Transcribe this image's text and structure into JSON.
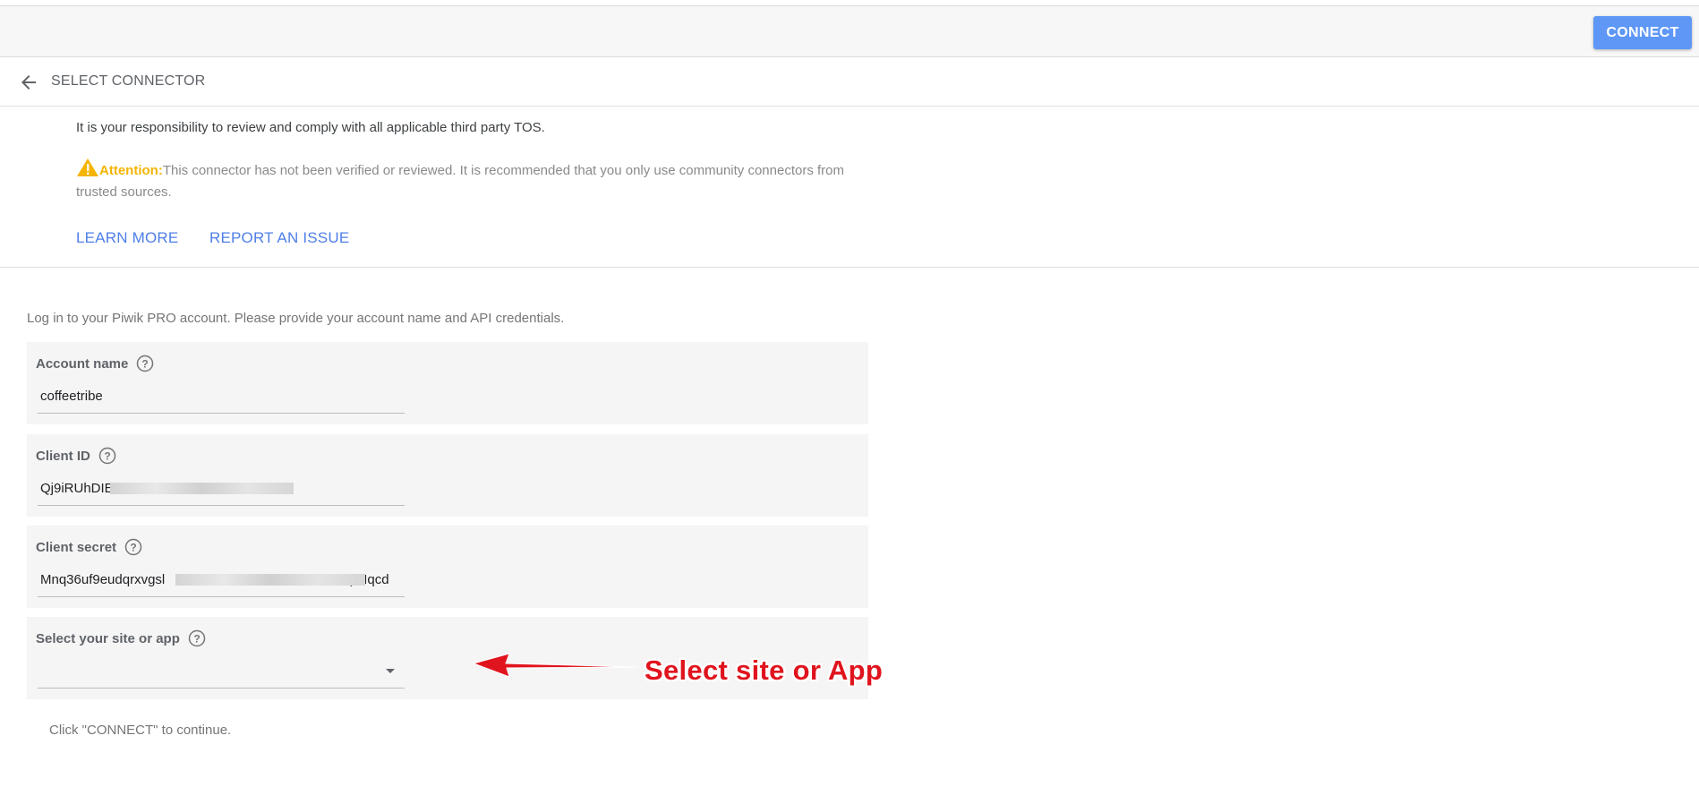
{
  "toolbar": {
    "connect_label": "CONNECT"
  },
  "header": {
    "title": "SELECT CONNECTOR",
    "back_icon": "arrow-back-icon"
  },
  "notice": {
    "tos": "It is your responsibility to review and comply with all applicable third party TOS.",
    "attention_label": "Attention:",
    "attention_text": "This connector has not been verified or reviewed. It is recommended that you only use community connectors from trusted sources.",
    "warning_icon": "warning-icon",
    "warning_color": "#f4b400"
  },
  "links": {
    "learn_more": "LEARN MORE",
    "report_issue": "REPORT AN ISSUE",
    "color": "#4f7fe8"
  },
  "form": {
    "intro": "Log in to your Piwik PRO account. Please provide your account name and API credentials.",
    "account_name": {
      "label": "Account name",
      "value": "coffeetribe"
    },
    "client_id": {
      "label": "Client ID",
      "value_start": "Qj9iRUhDIE",
      "value_end": "iEr5"
    },
    "client_secret": {
      "label": "Client secret",
      "value_start": "Mnq36uf9eudqrxvgsl",
      "value_end": ")KIqcd"
    },
    "site_select": {
      "label": "Select your site or app",
      "value": ""
    },
    "continue_text": "Click \"CONNECT\" to continue."
  },
  "annotation": {
    "text": "Select site or App",
    "color": "#e0141e"
  },
  "colors": {
    "accent": "#5e97f6"
  }
}
